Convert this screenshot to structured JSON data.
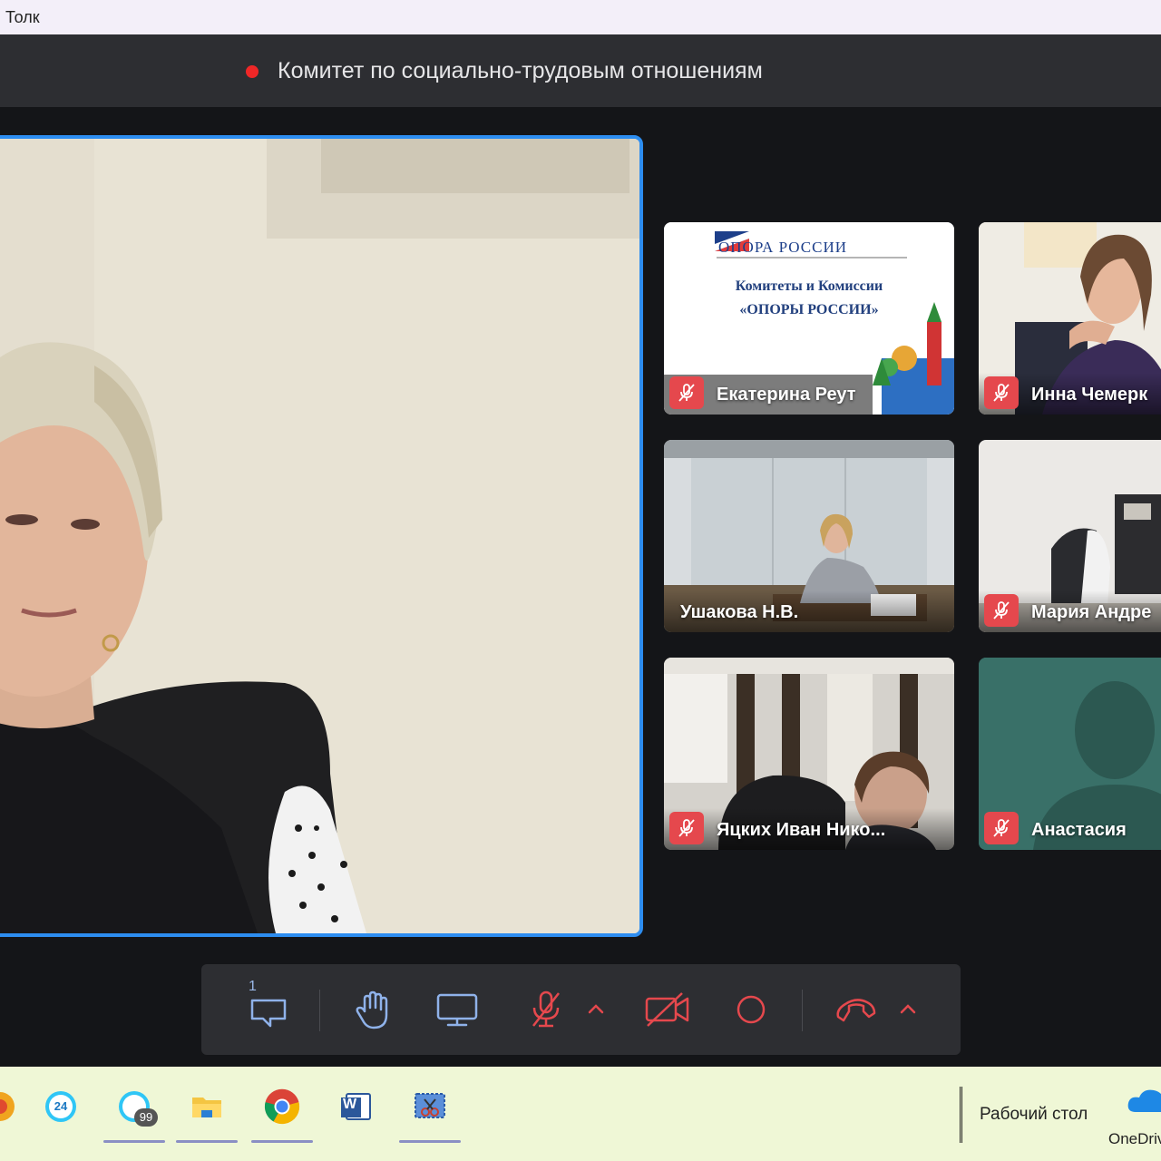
{
  "window": {
    "title": "Толк"
  },
  "header": {
    "meeting_title": "Комитет по социально-трудовым отношениям",
    "recording": true
  },
  "colors": {
    "accent": "#2d8df0",
    "mute_red": "#e5484d",
    "rec_red": "#ef2727",
    "panel": "#2d2e32"
  },
  "main_video": {
    "speaker_active": true
  },
  "participants": [
    {
      "name": "Екатерина Реут",
      "muted": true,
      "slide_lines": [
        "ОПОРА РОССИИ",
        "Комитеты и Комиссии",
        "«ОПОРЫ РОССИИ»"
      ]
    },
    {
      "name": "Инна Чемерк",
      "muted": true
    },
    {
      "name": "Ушакова Н.В.",
      "muted": false
    },
    {
      "name": "Мария Андре",
      "muted": true
    },
    {
      "name": "Яцких Иван Нико...",
      "muted": true
    },
    {
      "name": "Анастасия",
      "muted": true
    }
  ],
  "toolbar": {
    "chat_count": "1",
    "buttons": [
      "chat-icon",
      "raise-hand-icon",
      "screen-share-icon",
      "mic-off-icon",
      "chevron-up-icon",
      "camera-off-icon",
      "record-icon",
      "hang-up-icon",
      "chevron-up-icon"
    ]
  },
  "taskbar": {
    "apps": [
      {
        "icon": "bitrix24-icon",
        "badge": "24"
      },
      {
        "icon": "bitrix24-icon",
        "badge": "99"
      },
      {
        "icon": "file-explorer-icon"
      },
      {
        "icon": "chrome-icon"
      },
      {
        "icon": "word-icon",
        "badge": "W"
      },
      {
        "icon": "snipping-tool-icon"
      }
    ],
    "desktop_label": "Рабочий стол",
    "onedrive_label": "OneDrive"
  }
}
